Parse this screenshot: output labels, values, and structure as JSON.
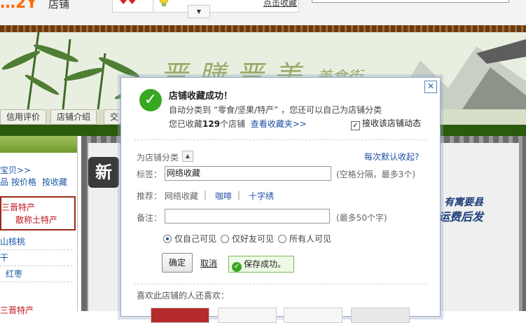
{
  "topbar": {
    "logo_text": "…2Y",
    "shop_label": "店铺",
    "favorite_link": "点击收藏",
    "dropdown_glyph": "▼"
  },
  "banner": {
    "title": "晋膳晋美",
    "subtitle": "美食街"
  },
  "nav": {
    "tabs": [
      "信用评价",
      "店铺介绍",
      "交"
    ]
  },
  "sidebar": {
    "all_items": "宝贝>>",
    "sort_options": [
      "品",
      "按价格",
      "按收藏"
    ],
    "specialty_line1": "三晋特产",
    "specialty_line2": "散称土特产",
    "categories": [
      "山核桃",
      "干",
      "红枣"
    ],
    "bottom_item": "三晋特产"
  },
  "content": {
    "badge": "新",
    "slogan_line1": "有寓要县",
    "slogan_line2": "运费后发"
  },
  "dialog": {
    "close_glyph": "✕",
    "success_title": "店铺收藏成功！",
    "category_line": "自动分类到 “零食/坚果/特产” ，您还可以自己为店铺分类",
    "count_prefix": "您已收藏",
    "count_value": "129",
    "count_suffix": "个店铺",
    "view_link": "查看收藏夹>>",
    "receive_label": "接收该店铺动态",
    "receive_checked": true,
    "classify_label": "为店铺分类",
    "default_fav_link": "每次默认收起?",
    "tag_label": "标签：",
    "tag_value": "网络收藏",
    "tag_hint": "(空格分隔，最多3个)",
    "recommend_label": "推荐：",
    "recommend_tags": [
      "网络收藏",
      "咖啡",
      "十字绣"
    ],
    "note_label": "备注：",
    "note_value": "",
    "note_hint": "(最多50个字)",
    "visibility_options": [
      "仅自己可见",
      "仅好友可见",
      "所有人可见"
    ],
    "visibility_selected": 0,
    "ok_button": "确定",
    "cancel_link": "取消",
    "saved_message": "保存成功。",
    "also_like": "喜欢此店铺的人还喜欢："
  }
}
